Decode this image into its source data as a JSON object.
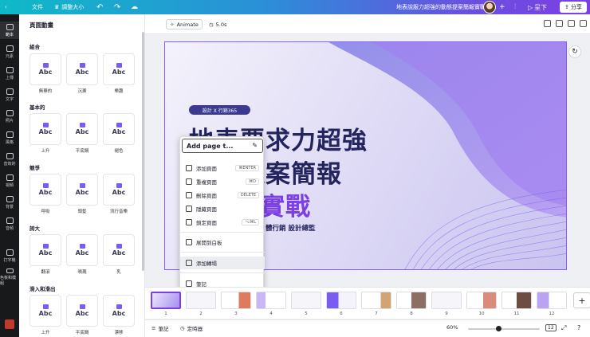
{
  "topbar": {
    "file_label": "文件",
    "resize_label": "調整大小",
    "doc_title": "地表說服力超強的動態提案簡報實戰",
    "present_label": "呈下",
    "share_label": "分享"
  },
  "rail": {
    "items": [
      {
        "label": "範本",
        "active": true
      },
      {
        "label": "元素"
      },
      {
        "label": "上傳"
      },
      {
        "label": "文字"
      },
      {
        "label": "照片"
      },
      {
        "label": "風格"
      },
      {
        "label": "音效的"
      },
      {
        "label": "視頻"
      },
      {
        "label": "背景"
      },
      {
        "label": "音頻"
      },
      {
        "label": "打字機"
      },
      {
        "label": "色板和模組"
      }
    ]
  },
  "panel": {
    "title": "頁面動畫",
    "sections": [
      {
        "name": "組合",
        "items": [
          "無華的",
          "沉澱",
          "樂趣"
        ]
      },
      {
        "name": "基本的",
        "items": [
          "上升",
          "平底鍋",
          "褪色"
        ]
      },
      {
        "name": "競爭",
        "items": [
          "呼吸",
          "頭髮",
          "流行音樂"
        ]
      },
      {
        "name": "誇大",
        "items": [
          "翻滾",
          "噴濺",
          "乳"
        ]
      },
      {
        "name": "滑入和滑出",
        "items": [
          "上升",
          "平底鍋",
          "漂移"
        ]
      }
    ],
    "card_text": "Abc"
  },
  "toolbar": {
    "animate_label": "Animate",
    "duration": "5.0s"
  },
  "slide": {
    "tag": "設計 X 行銷365",
    "line1": "地表要求力超強",
    "line2": "動態提案簡報",
    "line3": "A設計實戰",
    "subtitle": "體行銷  設計總監",
    "colors": {
      "navy": "#24245e",
      "purple": "#7b3fe4",
      "accent": "#8b5cf6"
    }
  },
  "context_menu": {
    "input_value": "Add page t...",
    "items": [
      {
        "label": "添加頁面",
        "shortcut": "⌘ENTER"
      },
      {
        "label": "重複頁面",
        "shortcut": "⌘D"
      },
      {
        "label": "刪除頁面",
        "shortcut": "DELETE"
      },
      {
        "label": "隱藏頁面",
        "shortcut": ""
      },
      {
        "label": "鎖定頁面",
        "shortcut": "⌥⌘L"
      },
      {
        "label": "展開到白板",
        "shortcut": ""
      },
      {
        "label": "添加轉場",
        "shortcut": ""
      },
      {
        "label": "筆記",
        "shortcut": ""
      }
    ]
  },
  "pages": {
    "numbers": [
      "1",
      "2",
      "3",
      "4",
      "5",
      "6",
      "7",
      "8",
      "9",
      "10",
      "11",
      "12"
    ],
    "selected": "1"
  },
  "bottombar": {
    "notes_label": "筆記",
    "timer_label": "定時器",
    "zoom": "60%",
    "page_count": "12"
  }
}
